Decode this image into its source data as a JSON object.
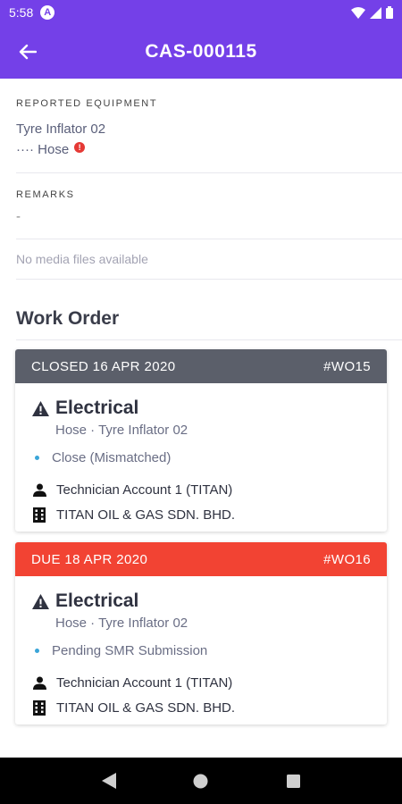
{
  "status_bar": {
    "time": "5:58",
    "app_badge": "A"
  },
  "app_bar": {
    "title": "CAS-000115"
  },
  "reported_equipment": {
    "label": "REPORTED EQUIPMENT",
    "equipment_name": "Tyre Inflator 02",
    "component": "···· Hose",
    "alert_badge": "!"
  },
  "remarks": {
    "label": "REMARKS",
    "value": "-"
  },
  "media": {
    "empty_text": "No media files available"
  },
  "work_order": {
    "heading": "Work Order",
    "cards": [
      {
        "header_status": "CLOSED 16 APR 2020",
        "wo_number": "#WO15",
        "header_color": "#5b5f6a",
        "title": "Electrical",
        "equipment": "Hose · Tyre Inflator 02",
        "status": "Close (Mismatched)",
        "technician": "Technician Account 1 (TITAN)",
        "company": "TITAN OIL & GAS SDN. BHD."
      },
      {
        "header_status": "DUE 18 APR 2020",
        "wo_number": "#WO16",
        "header_color": "#f24333",
        "title": "Electrical",
        "equipment": "Hose · Tyre Inflator 02",
        "status": "Pending SMR Submission",
        "technician": "Technician Account 1 (TITAN)",
        "company": "TITAN OIL & GAS SDN. BHD."
      }
    ]
  },
  "colors": {
    "primary": "#7440e8",
    "closed": "#5b5f6a",
    "due": "#f24333",
    "status_bullet": "#3aa5d8"
  },
  "icons": {
    "back": "arrow-left-icon",
    "warning": "warning-triangle-icon",
    "person": "person-icon",
    "building": "building-icon"
  }
}
